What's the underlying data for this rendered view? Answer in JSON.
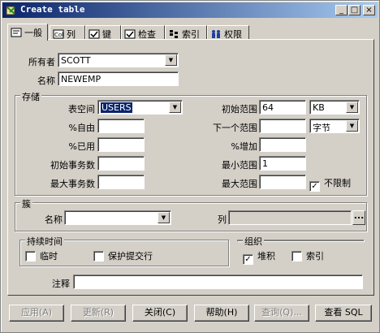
{
  "window": {
    "title": "Create table",
    "minimize": "_",
    "maximize": "□",
    "close": "×"
  },
  "tabs": [
    {
      "label": "一般"
    },
    {
      "label": "列"
    },
    {
      "label": "键"
    },
    {
      "label": "检查"
    },
    {
      "label": "索引"
    },
    {
      "label": "权限"
    }
  ],
  "general": {
    "owner_label": "所有者",
    "owner_value": "SCOTT",
    "name_label": "名称",
    "name_value": "NEWEMP"
  },
  "storage": {
    "title": "存储",
    "tablespace_label": "表空间",
    "tablespace_value": "USERS",
    "pctfree_label": "%自由",
    "pctfree_value": "",
    "pctused_label": "%已用",
    "pctused_value": "",
    "initrans_label": "初始事务数",
    "initrans_value": "",
    "maxtrans_label": "最大事务数",
    "maxtrans_value": "",
    "initial_label": "初始范围",
    "initial_value": "64",
    "initial_unit": "KB",
    "next_label": "下一个范围",
    "next_value": "",
    "next_unit": "字节",
    "pctincrease_label": "%增加",
    "pctincrease_value": "",
    "minextents_label": "最小范围",
    "minextents_value": "1",
    "maxextents_label": "最大范围",
    "maxextents_value": "",
    "unlimited_label": "不限制",
    "unlimited_checked": true
  },
  "cluster": {
    "title": "簇",
    "name_label": "名称",
    "name_value": "",
    "columns_label": "列",
    "columns_value": "",
    "browse": "..."
  },
  "duration": {
    "title": "持续时间",
    "temporary_label": "临时",
    "temporary_checked": false,
    "preserve_label": "保护提交行",
    "preserve_checked": false
  },
  "organization": {
    "title": "组织",
    "heap_label": "堆积",
    "heap_checked": true,
    "index_label": "索引",
    "index_checked": false
  },
  "comment": {
    "label": "注释",
    "value": ""
  },
  "buttons": {
    "apply": "应用(A)",
    "refresh": "更新(R)",
    "close": "关闭(C)",
    "help": "帮助(H)",
    "query": "查询(Q)...",
    "view_sql": "查看 SQL"
  }
}
